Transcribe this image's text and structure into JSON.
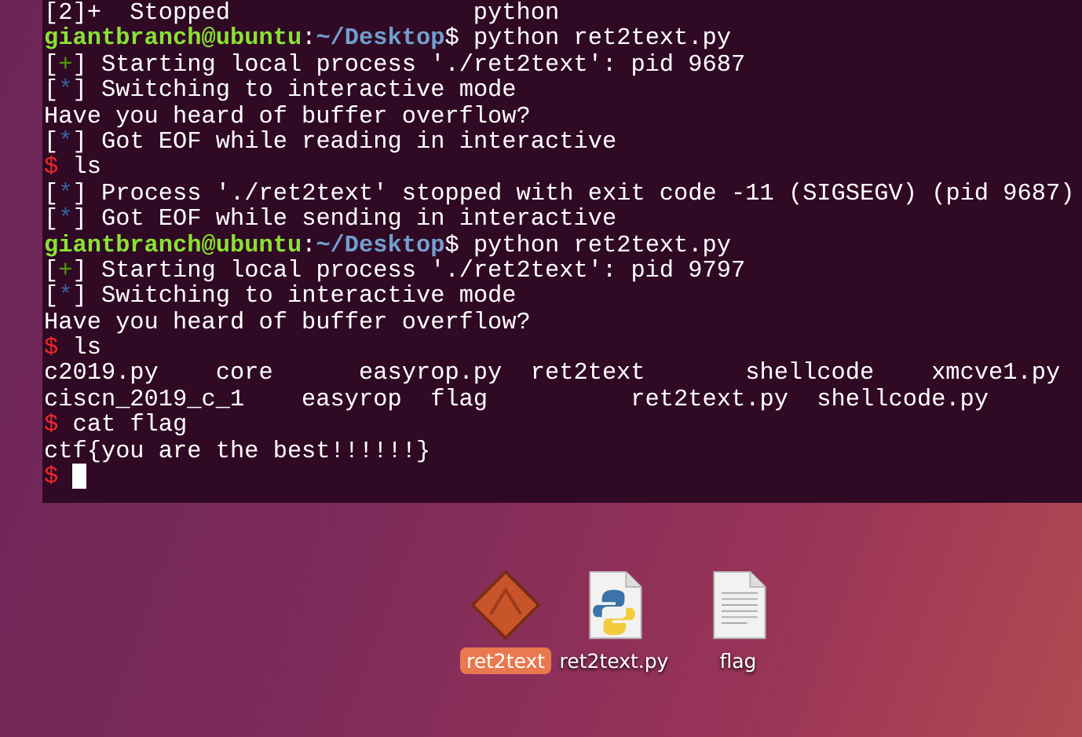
{
  "terminal": {
    "lines": [
      {
        "segments": [
          {
            "kind": "text",
            "text": "[2]+  Stopped                 python"
          }
        ]
      },
      {
        "segments": [
          {
            "kind": "user",
            "text": "giantbranch@ubuntu"
          },
          {
            "kind": "text",
            "text": ":"
          },
          {
            "kind": "path",
            "text": "~/Desktop"
          },
          {
            "kind": "text",
            "text": "$ python ret2text.py"
          }
        ]
      },
      {
        "segments": [
          {
            "kind": "text",
            "text": "["
          },
          {
            "kind": "plus",
            "text": "+"
          },
          {
            "kind": "text",
            "text": "] Starting local process './ret2text': pid 9687"
          }
        ]
      },
      {
        "segments": [
          {
            "kind": "text",
            "text": "["
          },
          {
            "kind": "star",
            "text": "*"
          },
          {
            "kind": "text",
            "text": "] Switching to interactive mode"
          }
        ]
      },
      {
        "segments": [
          {
            "kind": "text",
            "text": "Have you heard of buffer overflow?"
          }
        ]
      },
      {
        "segments": [
          {
            "kind": "text",
            "text": "["
          },
          {
            "kind": "star",
            "text": "*"
          },
          {
            "kind": "text",
            "text": "] Got EOF while reading in interactive"
          }
        ]
      },
      {
        "segments": [
          {
            "kind": "dollar",
            "text": "$"
          },
          {
            "kind": "text",
            "text": " ls"
          }
        ]
      },
      {
        "segments": [
          {
            "kind": "text",
            "text": "["
          },
          {
            "kind": "star",
            "text": "*"
          },
          {
            "kind": "text",
            "text": "] Process './ret2text' stopped with exit code -11 (SIGSEGV) (pid 9687)"
          }
        ]
      },
      {
        "segments": [
          {
            "kind": "text",
            "text": "["
          },
          {
            "kind": "star",
            "text": "*"
          },
          {
            "kind": "text",
            "text": "] Got EOF while sending in interactive"
          }
        ]
      },
      {
        "segments": [
          {
            "kind": "user",
            "text": "giantbranch@ubuntu"
          },
          {
            "kind": "text",
            "text": ":"
          },
          {
            "kind": "path",
            "text": "~/Desktop"
          },
          {
            "kind": "text",
            "text": "$ python ret2text.py"
          }
        ]
      },
      {
        "segments": [
          {
            "kind": "text",
            "text": "["
          },
          {
            "kind": "plus",
            "text": "+"
          },
          {
            "kind": "text",
            "text": "] Starting local process './ret2text': pid 9797"
          }
        ]
      },
      {
        "segments": [
          {
            "kind": "text",
            "text": "["
          },
          {
            "kind": "star",
            "text": "*"
          },
          {
            "kind": "text",
            "text": "] Switching to interactive mode"
          }
        ]
      },
      {
        "segments": [
          {
            "kind": "text",
            "text": "Have you heard of buffer overflow?"
          }
        ]
      },
      {
        "segments": [
          {
            "kind": "dollar",
            "text": "$"
          },
          {
            "kind": "text",
            "text": " ls"
          }
        ]
      },
      {
        "segments": [
          {
            "kind": "text",
            "text": "c2019.py    core      easyrop.py  ret2text       shellcode    xmcve1.py"
          }
        ]
      },
      {
        "segments": [
          {
            "kind": "text",
            "text": "ciscn_2019_c_1    easyrop  flag          ret2text.py  shellcode.py"
          }
        ]
      },
      {
        "segments": [
          {
            "kind": "dollar",
            "text": "$"
          },
          {
            "kind": "text",
            "text": " cat flag"
          }
        ]
      },
      {
        "segments": [
          {
            "kind": "text",
            "text": "ctf{you are the best!!!!!!}"
          }
        ]
      }
    ],
    "prompt": "$"
  },
  "desktop_icons": [
    {
      "kind": "executable",
      "label": "ret2text",
      "selected": true
    },
    {
      "kind": "python",
      "label": "ret2text.py",
      "selected": false
    },
    {
      "kind": "text",
      "label": "flag",
      "selected": false
    }
  ]
}
